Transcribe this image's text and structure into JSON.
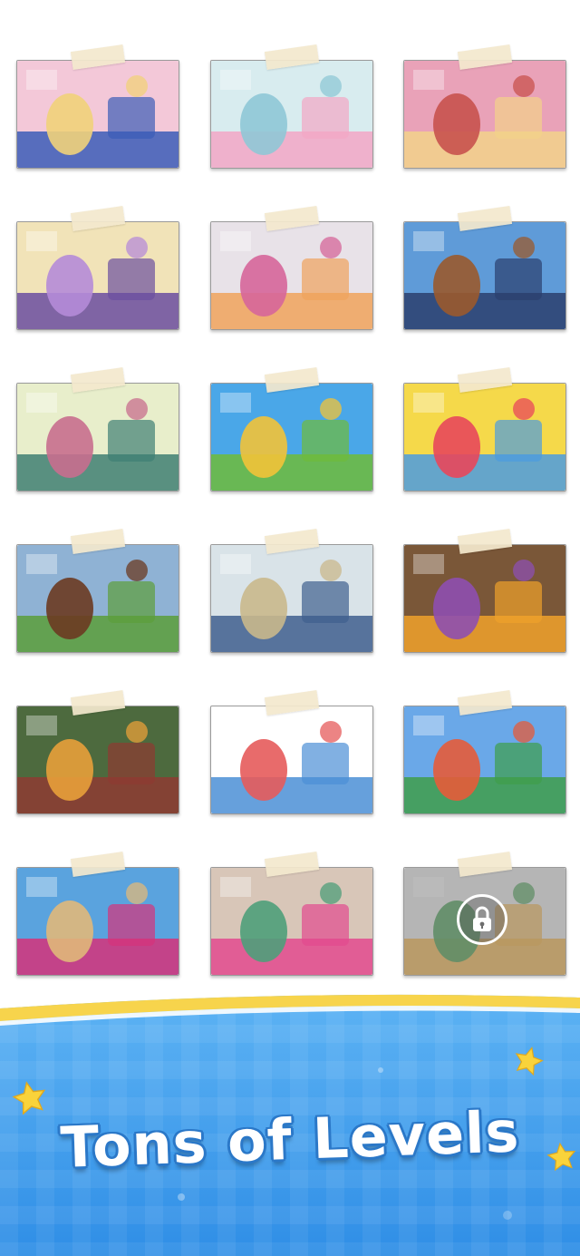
{
  "banner": {
    "title": "Tons of Levels",
    "colors": {
      "sky": "#4aa6f1",
      "stripe": "#f7d44c",
      "title_outline": "#2b78c8",
      "star": "#f9d33b"
    }
  },
  "levels": [
    {
      "id": "level-birthday-party",
      "theme": "birthday-party",
      "locked": false,
      "colors": [
        "#f3c8d8",
        "#3b5db8",
        "#f1d27a"
      ]
    },
    {
      "id": "level-bathroom",
      "theme": "bathroom",
      "locked": false,
      "colors": [
        "#d8ecef",
        "#f3a7c5",
        "#8fc8d6"
      ]
    },
    {
      "id": "level-kitchen",
      "theme": "kitchen",
      "locked": false,
      "colors": [
        "#e9a2b8",
        "#f2d289",
        "#c8524e"
      ]
    },
    {
      "id": "level-playroom",
      "theme": "playroom",
      "locked": false,
      "colors": [
        "#f1e3b8",
        "#6b4ea0",
        "#b58bd8"
      ]
    },
    {
      "id": "level-cat",
      "theme": "cat",
      "locked": false,
      "colors": [
        "#e8e2e8",
        "#f0a35c",
        "#d6669a"
      ]
    },
    {
      "id": "level-woody-car",
      "theme": "woody-car",
      "locked": false,
      "colors": [
        "#5f9bd8",
        "#2b3f6e",
        "#9a5a2e"
      ]
    },
    {
      "id": "level-woman-dog",
      "theme": "woman-dog",
      "locked": false,
      "colors": [
        "#e8eecb",
        "#3f7f73",
        "#c86e8e"
      ]
    },
    {
      "id": "level-jungle",
      "theme": "jungle",
      "locked": false,
      "colors": [
        "#4aa7e8",
        "#6fbb3a",
        "#f2c338"
      ]
    },
    {
      "id": "level-pop-art",
      "theme": "pop-art",
      "locked": false,
      "colors": [
        "#f5d94a",
        "#4b9be0",
        "#e8475b"
      ]
    },
    {
      "id": "level-horses",
      "theme": "horses",
      "locked": false,
      "colors": [
        "#8fb2d4",
        "#5c9e3a",
        "#6b3a21"
      ]
    },
    {
      "id": "level-cafe",
      "theme": "cafe",
      "locked": false,
      "colors": [
        "#d9e3e8",
        "#3f5f8e",
        "#c9b88c"
      ]
    },
    {
      "id": "level-honey",
      "theme": "honey",
      "locked": false,
      "colors": [
        "#7a5738",
        "#f0a12b",
        "#8e4fb0"
      ]
    },
    {
      "id": "level-living-room",
      "theme": "living-room",
      "locked": false,
      "colors": [
        "#4d6a3e",
        "#8e3b32",
        "#e8a03a"
      ]
    },
    {
      "id": "level-animal-stamps",
      "theme": "animal-stamps",
      "locked": false,
      "colors": [
        "#ffffff",
        "#4b8fd6",
        "#e65b5b"
      ]
    },
    {
      "id": "level-park-guell",
      "theme": "park-guell",
      "locked": false,
      "colors": [
        "#6aa8e8",
        "#3f9e4a",
        "#e65b3a"
      ]
    },
    {
      "id": "level-mediterranean",
      "theme": "mediterranean",
      "locked": false,
      "colors": [
        "#5aa3de",
        "#d6327a",
        "#e0b87a"
      ]
    },
    {
      "id": "level-havana-car",
      "theme": "havana-car",
      "locked": false,
      "colors": [
        "#d8c6b8",
        "#e34a8e",
        "#4f9e7a"
      ]
    },
    {
      "id": "level-locked-kitchen",
      "theme": "kitchen-sketch",
      "locked": true,
      "colors": [
        "#e8e8e8",
        "#f0b24a",
        "#4fa05a"
      ]
    }
  ]
}
